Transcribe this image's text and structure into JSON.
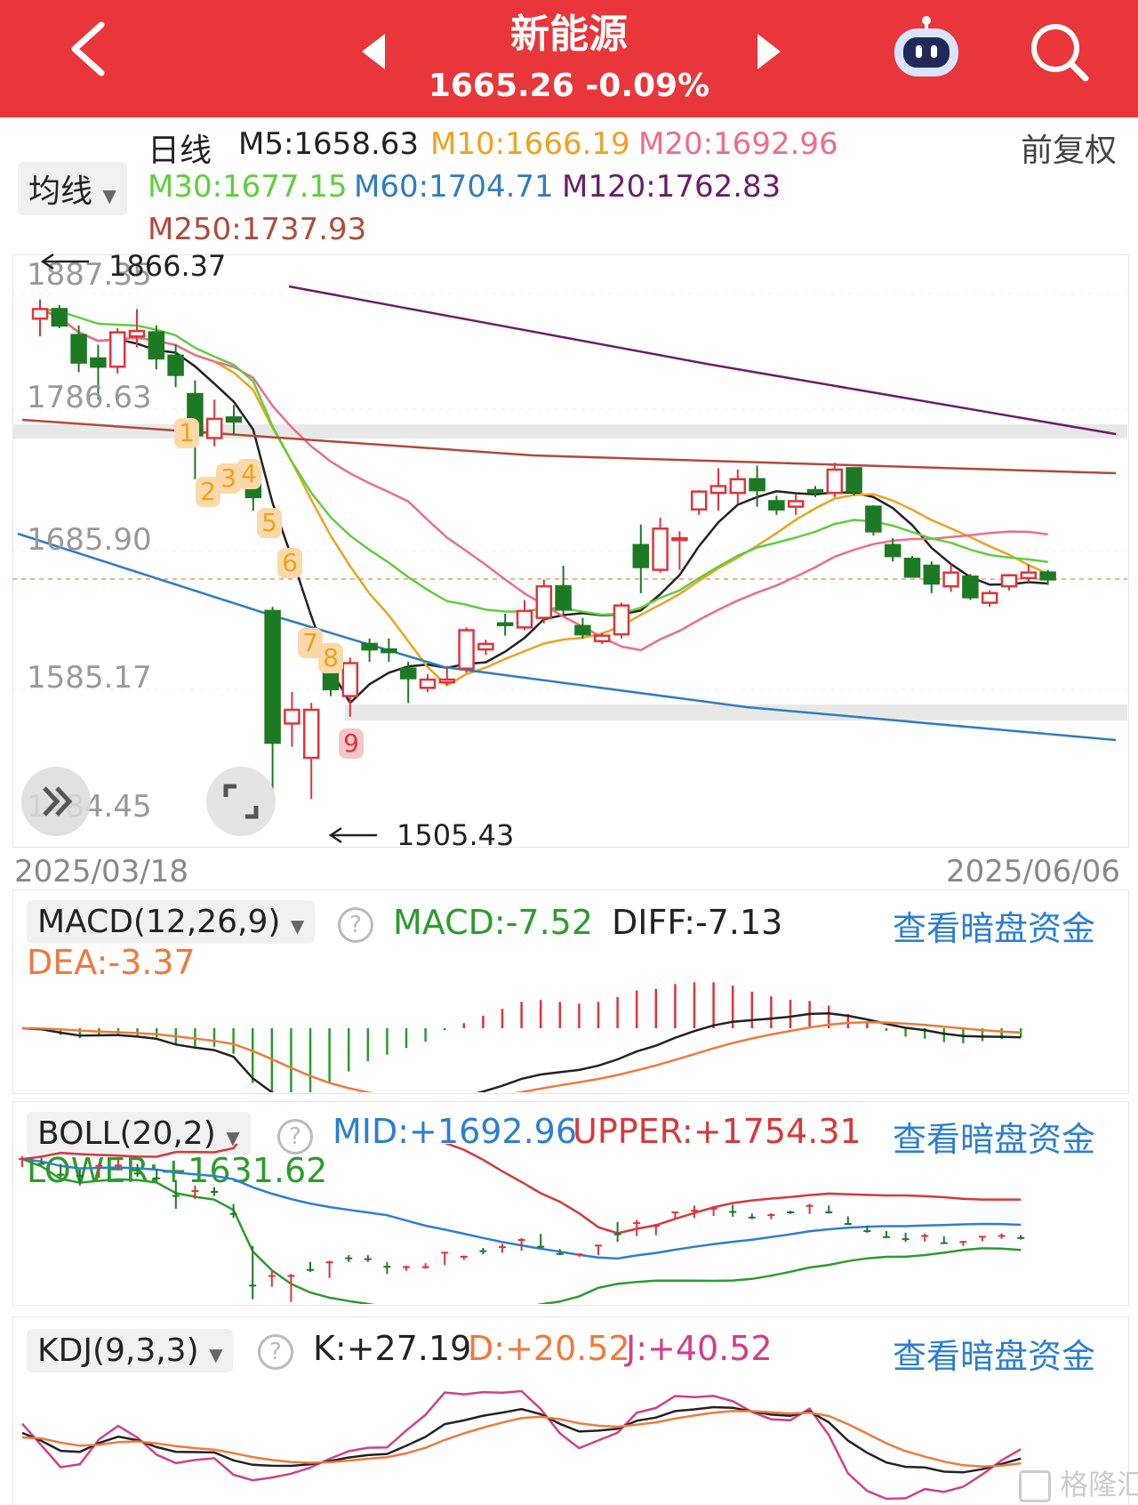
{
  "header": {
    "title": "新能源",
    "price": "1665.26",
    "change": "-0.09%"
  },
  "ma": {
    "period": "日线",
    "adjust": "前复权",
    "dropdown": "均线",
    "items": [
      {
        "label": "M5:1658.63",
        "color": "#222222"
      },
      {
        "label": "M10:1666.19",
        "color": "#f0a21e"
      },
      {
        "label": "M20:1692.96",
        "color": "#ee6d8a"
      },
      {
        "label": "M30:1677.15",
        "color": "#5fcf3c"
      },
      {
        "label": "M60:1704.71",
        "color": "#2e7cc4"
      },
      {
        "label": "M120:1762.83",
        "color": "#6b1c6e"
      },
      {
        "label": "M250:1737.93",
        "color": "#b04a3a"
      }
    ]
  },
  "kline": {
    "axis_labels": [
      "1887.35",
      "1786.63",
      "1685.90",
      "1585.17",
      "1484.45"
    ],
    "high_label": "1866.37",
    "low_label": "1505.43",
    "date_start": "2025/03/18",
    "date_end": "2025/06/06",
    "markers": [
      "1",
      "2",
      "3",
      "4",
      "5",
      "6",
      "7",
      "8",
      "9"
    ],
    "candles": [
      {
        "o": 1855,
        "h": 1869,
        "l": 1842,
        "c": 1862
      },
      {
        "o": 1862,
        "h": 1865,
        "l": 1848,
        "c": 1850
      },
      {
        "o": 1843,
        "h": 1850,
        "l": 1816,
        "c": 1823
      },
      {
        "o": 1826,
        "h": 1836,
        "l": 1796,
        "c": 1820
      },
      {
        "o": 1820,
        "h": 1848,
        "l": 1815,
        "c": 1845
      },
      {
        "o": 1842,
        "h": 1862,
        "l": 1834,
        "c": 1846
      },
      {
        "o": 1845,
        "h": 1850,
        "l": 1818,
        "c": 1826
      },
      {
        "o": 1828,
        "h": 1836,
        "l": 1805,
        "c": 1814
      },
      {
        "o": 1800,
        "h": 1810,
        "l": 1738,
        "c": 1770
      },
      {
        "o": 1768,
        "h": 1796,
        "l": 1762,
        "c": 1782
      },
      {
        "o": 1783,
        "h": 1792,
        "l": 1770,
        "c": 1780
      },
      {
        "o": 1740,
        "h": 1750,
        "l": 1715,
        "c": 1725
      },
      {
        "o": 1642,
        "h": 1645,
        "l": 1512,
        "c": 1546
      },
      {
        "o": 1560,
        "h": 1583,
        "l": 1543,
        "c": 1570
      },
      {
        "o": 1535,
        "h": 1575,
        "l": 1505,
        "c": 1570
      },
      {
        "o": 1602,
        "h": 1605,
        "l": 1580,
        "c": 1585
      },
      {
        "o": 1580,
        "h": 1608,
        "l": 1565,
        "c": 1604
      },
      {
        "o": 1618,
        "h": 1622,
        "l": 1605,
        "c": 1614
      },
      {
        "o": 1614,
        "h": 1622,
        "l": 1605,
        "c": 1612
      },
      {
        "o": 1600,
        "h": 1605,
        "l": 1575,
        "c": 1593
      },
      {
        "o": 1586,
        "h": 1596,
        "l": 1583,
        "c": 1592
      },
      {
        "o": 1590,
        "h": 1602,
        "l": 1588,
        "c": 1592
      },
      {
        "o": 1600,
        "h": 1630,
        "l": 1597,
        "c": 1628
      },
      {
        "o": 1614,
        "h": 1621,
        "l": 1610,
        "c": 1618
      },
      {
        "o": 1633,
        "h": 1640,
        "l": 1624,
        "c": 1632
      },
      {
        "o": 1630,
        "h": 1650,
        "l": 1628,
        "c": 1642
      },
      {
        "o": 1637,
        "h": 1665,
        "l": 1633,
        "c": 1660
      },
      {
        "o": 1660,
        "h": 1675,
        "l": 1640,
        "c": 1643
      },
      {
        "o": 1631,
        "h": 1637,
        "l": 1622,
        "c": 1625
      },
      {
        "o": 1620,
        "h": 1626,
        "l": 1618,
        "c": 1624
      },
      {
        "o": 1625,
        "h": 1648,
        "l": 1622,
        "c": 1646
      },
      {
        "o": 1690,
        "h": 1705,
        "l": 1655,
        "c": 1674
      },
      {
        "o": 1672,
        "h": 1710,
        "l": 1670,
        "c": 1702
      },
      {
        "o": 1695,
        "h": 1700,
        "l": 1672,
        "c": 1695
      },
      {
        "o": 1716,
        "h": 1730,
        "l": 1712,
        "c": 1729
      },
      {
        "o": 1728,
        "h": 1746,
        "l": 1715,
        "c": 1733
      },
      {
        "o": 1728,
        "h": 1745,
        "l": 1720,
        "c": 1738
      },
      {
        "o": 1738,
        "h": 1748,
        "l": 1718,
        "c": 1730
      },
      {
        "o": 1722,
        "h": 1726,
        "l": 1712,
        "c": 1716
      },
      {
        "o": 1718,
        "h": 1727,
        "l": 1712,
        "c": 1722
      },
      {
        "o": 1730,
        "h": 1733,
        "l": 1725,
        "c": 1729
      },
      {
        "o": 1728,
        "h": 1750,
        "l": 1725,
        "c": 1745
      },
      {
        "o": 1746,
        "h": 1746,
        "l": 1726,
        "c": 1729
      },
      {
        "o": 1718,
        "h": 1719,
        "l": 1697,
        "c": 1700
      },
      {
        "o": 1690,
        "h": 1695,
        "l": 1678,
        "c": 1682
      },
      {
        "o": 1680,
        "h": 1682,
        "l": 1667,
        "c": 1667
      },
      {
        "o": 1675,
        "h": 1678,
        "l": 1655,
        "c": 1662
      },
      {
        "o": 1660,
        "h": 1676,
        "l": 1656,
        "c": 1670
      },
      {
        "o": 1667,
        "h": 1669,
        "l": 1650,
        "c": 1652
      },
      {
        "o": 1648,
        "h": 1657,
        "l": 1645,
        "c": 1655
      },
      {
        "o": 1660,
        "h": 1669,
        "l": 1657,
        "c": 1668
      },
      {
        "o": 1666,
        "h": 1676,
        "l": 1663,
        "c": 1670
      },
      {
        "o": 1670,
        "h": 1672,
        "l": 1661,
        "c": 1665
      }
    ]
  },
  "macd": {
    "dropdown": "MACD(12,26,9)",
    "help": "?",
    "macd": "MACD:-7.52",
    "diff": "DIFF:-7.13",
    "dea": "DEA:-3.37",
    "link": "查看暗盘资金"
  },
  "boll": {
    "dropdown": "BOLL(20,2)",
    "help": "?",
    "mid": "MID:+1692.96",
    "upper": "UPPER:+1754.31",
    "lower": "LOWER:+1631.62",
    "link": "查看暗盘资金"
  },
  "kdj": {
    "dropdown": "KDJ(9,3,3)",
    "help": "?",
    "k": "K:+27.19",
    "d": "D:+20.52",
    "j": "J:+40.52",
    "link": "查看暗盘资金"
  },
  "watermark": "格隆汇"
}
